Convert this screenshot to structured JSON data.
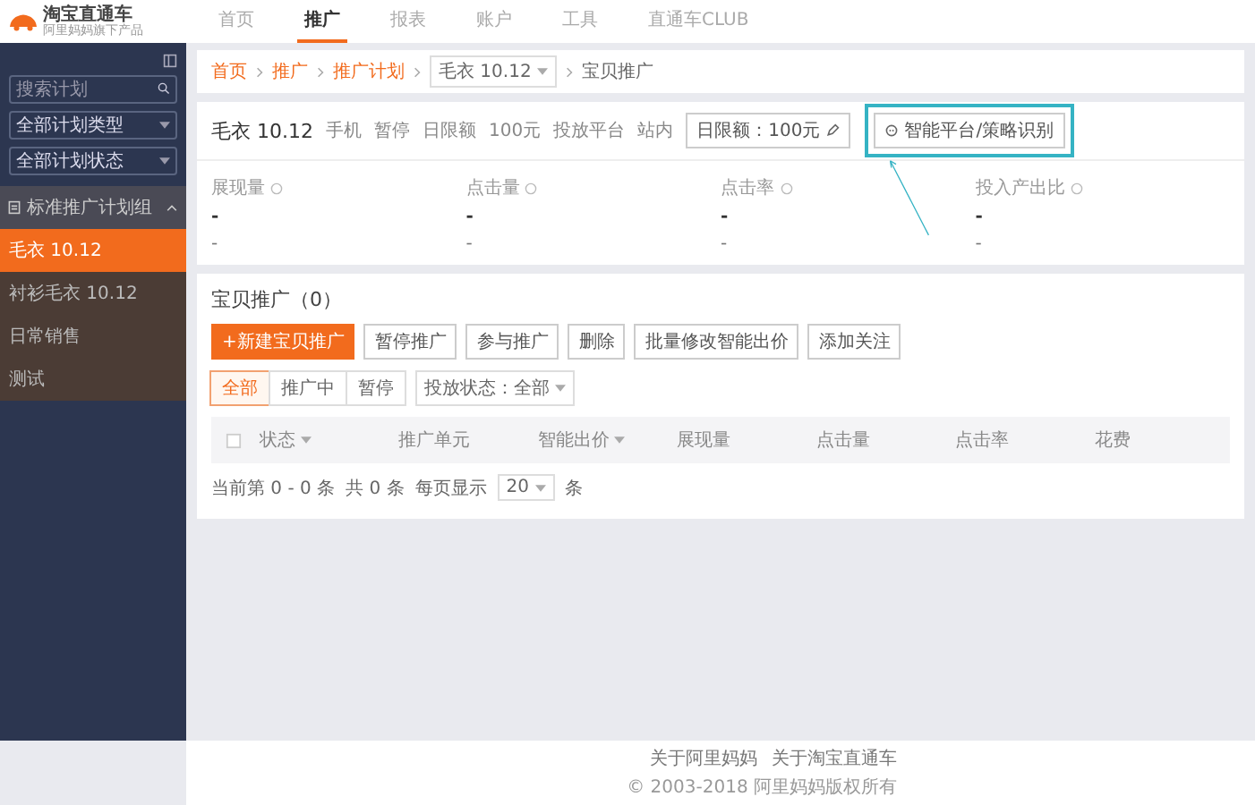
{
  "logo": {
    "title": "淘宝直通车",
    "subtitle": "阿里妈妈旗下产品"
  },
  "nav": [
    {
      "label": "首页",
      "selected": false
    },
    {
      "label": "推广",
      "selected": true
    },
    {
      "label": "报表",
      "selected": false
    },
    {
      "label": "账户",
      "selected": false
    },
    {
      "label": "工具",
      "selected": false
    },
    {
      "label": "直通车CLUB",
      "selected": false
    }
  ],
  "sidebar": {
    "search": {
      "placeholder": "搜索计划"
    },
    "filters": [
      "全部计划类型",
      "全部计划状态"
    ],
    "group": {
      "label": "标准推广计划组",
      "expanded": true
    },
    "items": [
      {
        "label": "毛衣 10.12",
        "selected": true
      },
      {
        "label": "衬衫毛衣 10.12",
        "selected": false
      },
      {
        "label": "日常销售",
        "selected": false
      },
      {
        "label": "测试",
        "selected": false
      }
    ]
  },
  "breadcrumb": {
    "items": [
      "首页",
      "推广",
      "推广计划"
    ],
    "plan_select": "毛衣 10.12",
    "current": "宝贝推广"
  },
  "plan": {
    "name": "毛衣 10.12",
    "meta": [
      "手机",
      "暂停",
      "日限额",
      "100元",
      "投放平台",
      "站内"
    ],
    "buttons": [
      {
        "label": "日限额：100元",
        "kind": "edit",
        "highlighted": false
      },
      {
        "label": "智能平台/策略识别",
        "kind": "smart",
        "highlighted": true
      }
    ],
    "metrics": [
      {
        "label": "展现量",
        "value": "-",
        "sub": "-"
      },
      {
        "label": "点击量",
        "value": "-",
        "sub": "-"
      },
      {
        "label": "点击率",
        "value": "-",
        "sub": "-"
      },
      {
        "label": "投入产出比",
        "value": "-",
        "sub": "-"
      }
    ]
  },
  "promo": {
    "title": "宝贝推广（0）",
    "actions": [
      {
        "label": "+新建宝贝推广",
        "kind": "primary"
      },
      {
        "label": "暂停推广",
        "kind": "plain"
      },
      {
        "label": "参与推广",
        "kind": "plain"
      },
      {
        "label": "删除",
        "kind": "plain"
      },
      {
        "label": "批量修改智能出价",
        "kind": "plain"
      },
      {
        "label": "添加关注",
        "kind": "plain"
      }
    ],
    "tabs": [
      {
        "label": "全部",
        "selected": true
      },
      {
        "label": "推广中",
        "selected": false
      },
      {
        "label": "暂停",
        "selected": false
      }
    ],
    "status_filter": "投放状态：全部",
    "select_all": {
      "checked": false
    },
    "columns": [
      {
        "label": "状态",
        "dropdown": true
      },
      {
        "label": "推广单元",
        "dropdown": false
      },
      {
        "label": "智能出价",
        "dropdown": true
      },
      {
        "label": "展现量",
        "dropdown": false
      },
      {
        "label": "点击量",
        "dropdown": false
      },
      {
        "label": "点击率",
        "dropdown": false
      },
      {
        "label": "花费",
        "dropdown": false
      }
    ],
    "pagination": {
      "range": "当前第 0 - 0 条",
      "total": "共 0 条",
      "per_page_label": "每页显示",
      "per_page": "20",
      "unit": "条"
    }
  },
  "footer": {
    "links": [
      "关于阿里妈妈",
      "关于淘宝直通车"
    ],
    "copyright": "© 2003-2018 阿里妈妈版权所有"
  }
}
